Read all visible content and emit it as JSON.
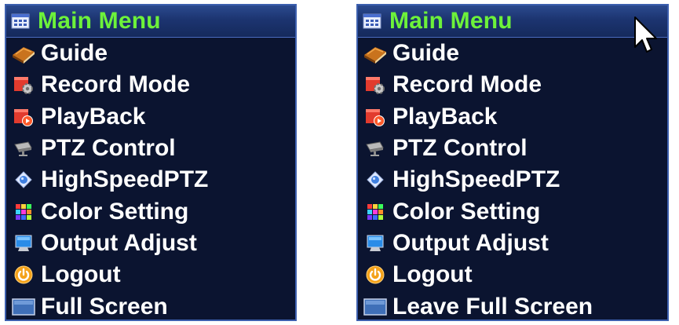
{
  "left_menu": {
    "title": "Main Menu",
    "title_icon": "menu-grid-icon",
    "items": [
      {
        "label": "Guide",
        "icon": "book-icon"
      },
      {
        "label": "Record Mode",
        "icon": "record-gear-icon"
      },
      {
        "label": "PlayBack",
        "icon": "playback-icon"
      },
      {
        "label": "PTZ Control",
        "icon": "ptz-camera-icon"
      },
      {
        "label": "HighSpeedPTZ",
        "icon": "dome-camera-icon"
      },
      {
        "label": "Color Setting",
        "icon": "color-grid-icon"
      },
      {
        "label": "Output Adjust",
        "icon": "monitor-icon"
      },
      {
        "label": "Logout",
        "icon": "power-icon"
      },
      {
        "label": "Full Screen",
        "icon": "fullscreen-icon"
      }
    ]
  },
  "right_menu": {
    "title": "Main Menu",
    "title_icon": "menu-grid-icon",
    "items": [
      {
        "label": "Guide",
        "icon": "book-icon"
      },
      {
        "label": "Record Mode",
        "icon": "record-gear-icon"
      },
      {
        "label": "PlayBack",
        "icon": "playback-icon"
      },
      {
        "label": "PTZ Control",
        "icon": "ptz-camera-icon"
      },
      {
        "label": "HighSpeedPTZ",
        "icon": "dome-camera-icon"
      },
      {
        "label": "Color Setting",
        "icon": "color-grid-icon"
      },
      {
        "label": "Output Adjust",
        "icon": "monitor-icon"
      },
      {
        "label": "Logout",
        "icon": "power-icon"
      },
      {
        "label": "Leave Full Screen",
        "icon": "fullscreen-icon"
      }
    ]
  },
  "colors": {
    "menu_background": "#0b1430",
    "menu_border": "#3c5fae",
    "title_text": "#6df23a",
    "item_text": "#ffffff"
  }
}
